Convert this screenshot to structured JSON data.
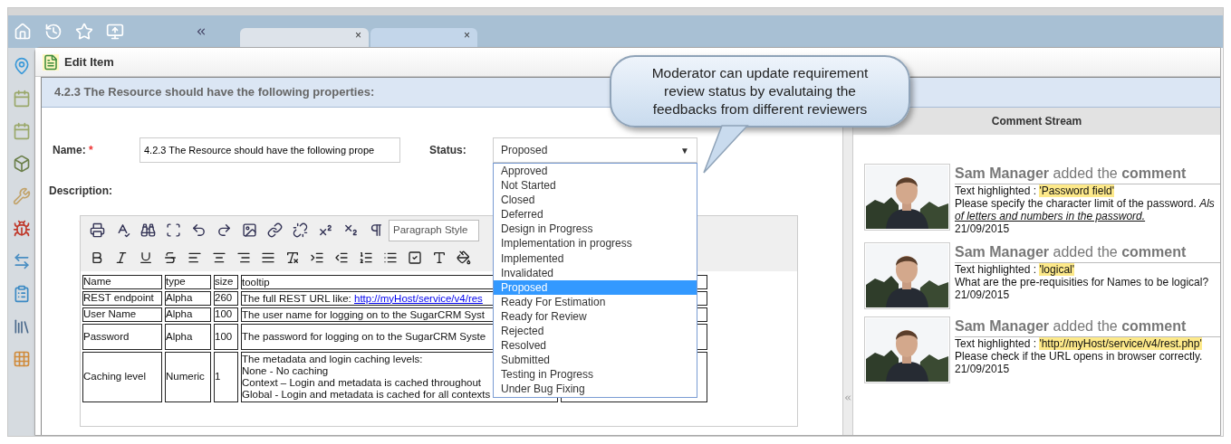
{
  "tabs": [
    {
      "selected": false,
      "close": "×"
    },
    {
      "selected": true,
      "close": "×"
    }
  ],
  "dialog": {
    "title": "Edit Item",
    "section_title": "4.2.3 The Resource should have the following properties:",
    "name_label": "Name:",
    "required_mark": "*",
    "name_value": "4.2.3 The Resource should have the following prope",
    "status_label": "Status:",
    "status_value": "Proposed",
    "caret": "▼",
    "status_options": [
      {
        "label": "Approved",
        "selected": false
      },
      {
        "label": "Not Started",
        "selected": false
      },
      {
        "label": "Closed",
        "selected": false
      },
      {
        "label": "Deferred",
        "selected": false
      },
      {
        "label": "Design in Progress",
        "selected": false
      },
      {
        "label": "Implementation in progress",
        "selected": false
      },
      {
        "label": "Implemented",
        "selected": false
      },
      {
        "label": "Invalidated",
        "selected": false
      },
      {
        "label": "Proposed",
        "selected": true
      },
      {
        "label": "Ready For Estimation",
        "selected": false
      },
      {
        "label": "Ready for Review",
        "selected": false
      },
      {
        "label": "Rejected",
        "selected": false
      },
      {
        "label": "Resolved",
        "selected": false
      },
      {
        "label": "Submitted",
        "selected": false
      },
      {
        "label": "Testing in Progress",
        "selected": false
      },
      {
        "label": "Under Bug Fixing",
        "selected": false
      }
    ],
    "description_label": "Description:",
    "paragraph_style": "Paragraph Style",
    "table_rows": [
      {
        "cells": [
          "Name",
          "type",
          "size"
        ],
        "tooltip": [
          "tooltip"
        ]
      },
      {
        "cells": [
          "REST endpoint",
          "Alpha",
          "260"
        ],
        "tooltip": [
          "The full REST URL like: "
        ],
        "link": "http://myHost/service/v4/res"
      },
      {
        "cells": [
          "User Name",
          "Alpha",
          "100"
        ],
        "tooltip": [
          "The user name for logging on to the SugarCRM Syst"
        ]
      },
      {
        "cells": [
          "Password",
          "Alpha",
          "100"
        ],
        "tooltip": [
          "The password for logging on to the SugarCRM Syste"
        ]
      },
      {
        "cells": [
          "Caching level",
          "Numeric",
          "1"
        ],
        "tooltip": [
          "The metadata and login caching levels:",
          "None - No caching",
          "Context – Login and metadata is cached throughout",
          "Global - Login and metadata is cached for all contexts"
        ]
      }
    ]
  },
  "callout": [
    "Moderator can update requirement",
    "review status by evalutaing the",
    "feedbacks from different reviewers"
  ],
  "comment_stream": {
    "title": "Comment Stream",
    "comments": [
      {
        "heading": "**Sam Manager** added the **comment**",
        "highlight_label": "Text highlighted : ",
        "highlight": "'Password field'",
        "lines": [
          {
            "text": "Please specify the character limit of the password. *Als*",
            "italic": false
          },
          {
            "text": "of letters and numbers in the password.",
            "italic": true
          }
        ],
        "date": "21/09/2015"
      },
      {
        "heading": "**Sam Manager** added the **comment**",
        "highlight_label": "Text highlighted : ",
        "highlight": "'logical'",
        "lines": [
          {
            "text": "What are the pre-requisities for Names to be logical?",
            "italic": false
          }
        ],
        "date": "21/09/2015"
      },
      {
        "heading": "**Sam Manager** added the **comment**",
        "highlight_label": "Text highlighted : ",
        "highlight": "'http://myHost/service/v4/rest.php'",
        "lines": [
          {
            "text": "Please check if the URL opens in browser correctly.",
            "italic": false
          }
        ],
        "date": "21/09/2015"
      }
    ]
  }
}
